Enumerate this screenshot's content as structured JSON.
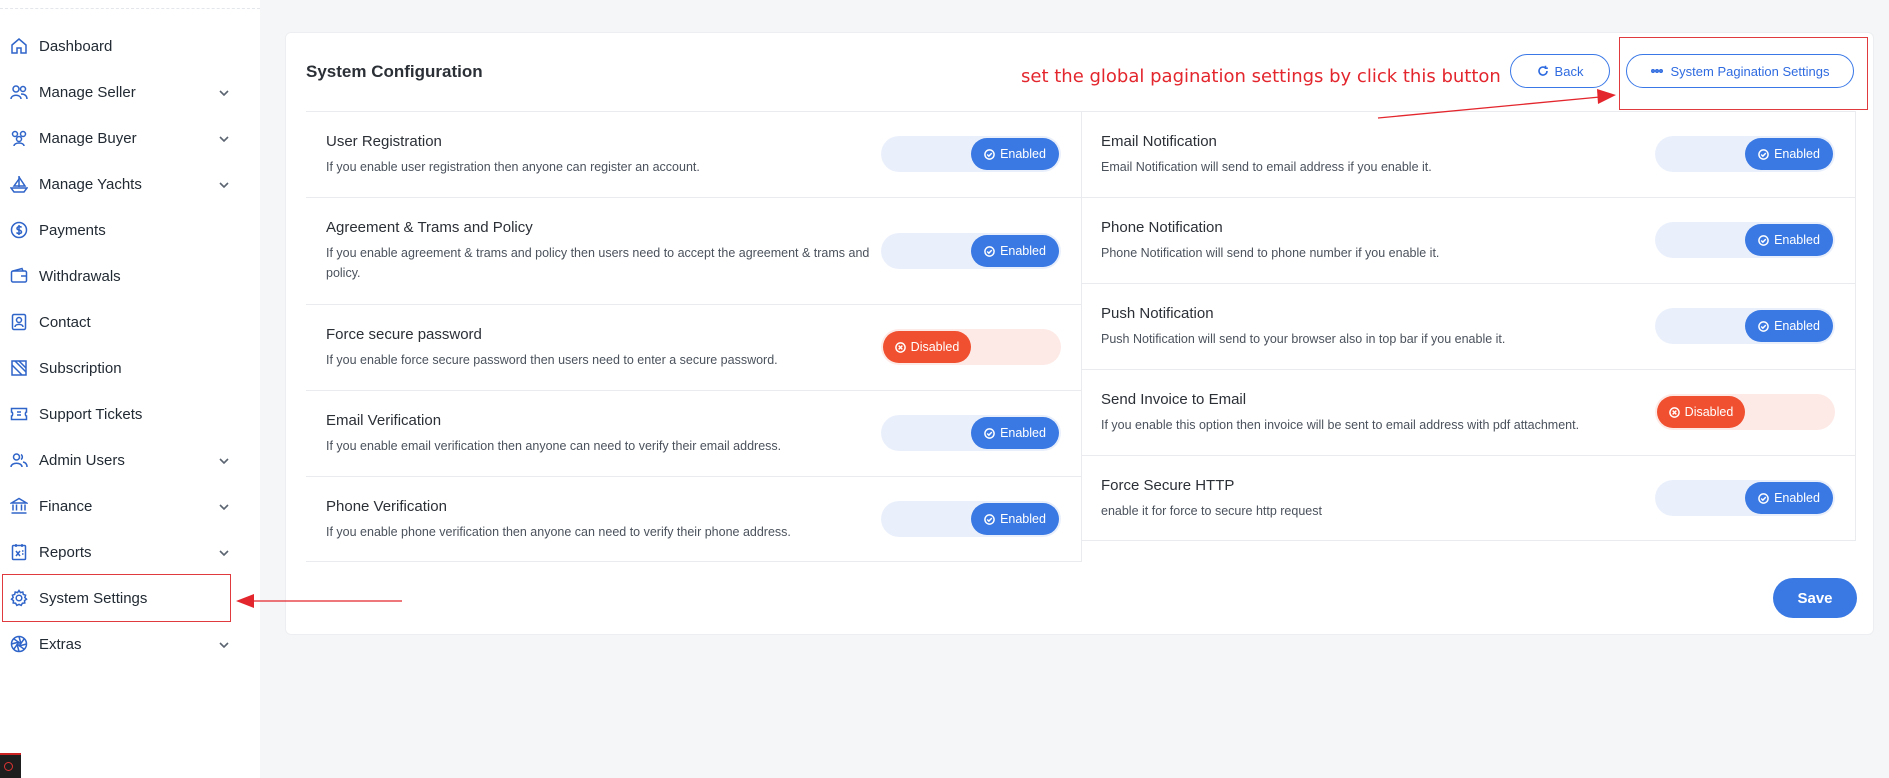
{
  "sidebar": {
    "items": [
      {
        "label": "Dashboard",
        "icon": "home-icon",
        "has_children": false
      },
      {
        "label": "Manage Seller",
        "icon": "users-icon",
        "has_children": true
      },
      {
        "label": "Manage Buyer",
        "icon": "group-icon",
        "has_children": true
      },
      {
        "label": "Manage Yachts",
        "icon": "boat-icon",
        "has_children": true
      },
      {
        "label": "Payments",
        "icon": "dollar-circle-icon",
        "has_children": false
      },
      {
        "label": "Withdrawals",
        "icon": "wallet-icon",
        "has_children": false
      },
      {
        "label": "Contact",
        "icon": "contact-icon",
        "has_children": false
      },
      {
        "label": "Subscription",
        "icon": "ticket-icon",
        "has_children": false
      },
      {
        "label": "Support Tickets",
        "icon": "support-ticket-icon",
        "has_children": false
      },
      {
        "label": "Admin Users",
        "icon": "admin-users-icon",
        "has_children": true
      },
      {
        "label": "Finance",
        "icon": "bank-icon",
        "has_children": true
      },
      {
        "label": "Reports",
        "icon": "report-icon",
        "has_children": true
      },
      {
        "label": "System Settings",
        "icon": "gear-icon",
        "has_children": false,
        "active": true
      },
      {
        "label": "Extras",
        "icon": "aperture-icon",
        "has_children": true
      }
    ]
  },
  "page": {
    "title": "System Configuration",
    "annotation": "set the global pagination settings by click this button",
    "back_label": "Back",
    "pagination_label": "System Pagination Settings",
    "save_label": "Save"
  },
  "settings": {
    "left": [
      {
        "title": "User Registration",
        "desc": "If you enable user registration then anyone can register an account.",
        "state": "Enabled"
      },
      {
        "title": "Agreement & Trams and Policy",
        "desc": "If you enable agreement & trams and policy then users need to accept the agreement & trams and policy.",
        "state": "Enabled"
      },
      {
        "title": "Force secure password",
        "desc": "If you enable force secure password then users need to enter a secure password.",
        "state": "Disabled"
      },
      {
        "title": "Email Verification",
        "desc": "If you enable email verification then anyone can need to verify their email address.",
        "state": "Enabled"
      },
      {
        "title": "Phone Verification",
        "desc": "If you enable phone verification then anyone can need to verify their phone address.",
        "state": "Enabled"
      }
    ],
    "right": [
      {
        "title": "Email Notification",
        "desc": "Email Notification will send to email address if you enable it.",
        "state": "Enabled"
      },
      {
        "title": "Phone Notification",
        "desc": "Phone Notification will send to phone number if you enable it.",
        "state": "Enabled"
      },
      {
        "title": "Push Notification",
        "desc": "Push Notification will send to your browser also in top bar if you enable it.",
        "state": "Enabled"
      },
      {
        "title": "Send Invoice to Email",
        "desc": "If you enable this option then invoice will be sent to email address with pdf attachment.",
        "state": "Disabled"
      },
      {
        "title": "Force Secure HTTP",
        "desc": "enable it for force to secure http request",
        "state": "Enabled"
      }
    ]
  },
  "colors": {
    "accent": "#3a79e3",
    "enabled_track": "#eaf0fb",
    "disabled_pill": "#f0502f",
    "disabled_track": "#fde9e6",
    "annotation": "#e3262d"
  }
}
